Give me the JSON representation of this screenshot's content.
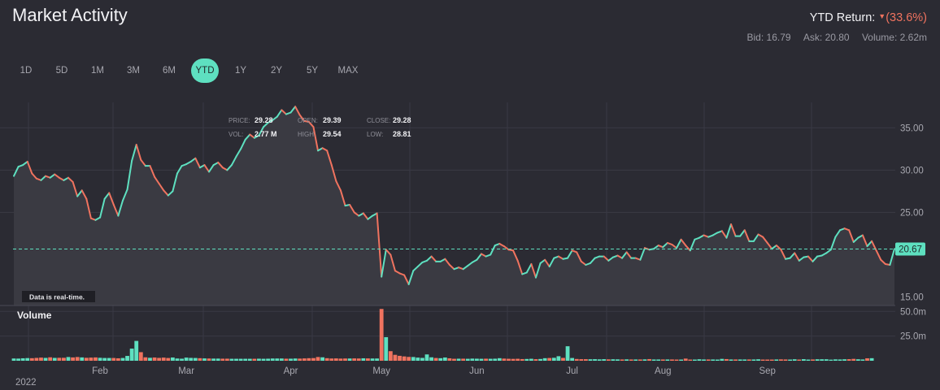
{
  "header": {
    "title": "Market Activity",
    "ytd_label": "YTD Return:",
    "ytd_value": "(33.6%)",
    "bid": "Bid: 16.79",
    "ask": "Ask: 20.80",
    "volume": "Volume: 2.62m"
  },
  "ranges": [
    {
      "label": "1D",
      "active": false
    },
    {
      "label": "5D",
      "active": false
    },
    {
      "label": "1M",
      "active": false
    },
    {
      "label": "3M",
      "active": false
    },
    {
      "label": "6M",
      "active": false
    },
    {
      "label": "YTD",
      "active": true
    },
    {
      "label": "1Y",
      "active": false
    },
    {
      "label": "2Y",
      "active": false
    },
    {
      "label": "5Y",
      "active": false
    },
    {
      "label": "MAX",
      "active": false
    }
  ],
  "tooltip": {
    "price_label": "PRICE:",
    "price": "29.28",
    "open_label": "OPEN:",
    "open": "29.39",
    "close_label": "CLOSE:",
    "close": "29.28",
    "vol_label": "VOL:",
    "vol": "2.77 M",
    "high_label": "HIGH:",
    "high": "29.54",
    "low_label": "LOW:",
    "low": "28.81"
  },
  "realtime_note": "Data is real-time.",
  "volume_title": "Volume",
  "year_label": "2022",
  "current_price_label": "20.67",
  "colors": {
    "up": "#5ee0c0",
    "down": "#f0735f",
    "area": "#3a3a42",
    "bg": "#2b2b33",
    "grid": "#3a3a44"
  },
  "chart_data": {
    "type": "line",
    "x_unit": "trading day index (0 = first trading day of 2022, 184 = last shown)",
    "xticks": [
      {
        "label": "Feb",
        "day": 19
      },
      {
        "label": "Mar",
        "day": 38
      },
      {
        "label": "Apr",
        "day": 61
      },
      {
        "label": "May",
        "day": 81
      },
      {
        "label": "Jun",
        "day": 102
      },
      {
        "label": "Jul",
        "day": 123
      },
      {
        "label": "Aug",
        "day": 143
      },
      {
        "label": "Sep",
        "day": 166
      }
    ],
    "price_ticks": [
      "35.00",
      "30.00",
      "25.00",
      "15.00"
    ],
    "price_tick_values": [
      35,
      30,
      25,
      15
    ],
    "ylim": [
      14,
      38
    ],
    "volume_ticks": [
      "50.0m",
      "25.0m"
    ],
    "volume_tick_values": [
      50,
      25
    ],
    "volume_ylim": [
      0,
      56
    ],
    "reference_price": 20.67,
    "price": [
      29.3,
      30.4,
      30.6,
      31.0,
      29.6,
      29.0,
      28.8,
      29.3,
      29.1,
      29.5,
      29.1,
      28.8,
      29.1,
      28.6,
      26.9,
      27.6,
      26.6,
      24.3,
      24.1,
      24.4,
      26.6,
      27.3,
      25.9,
      24.6,
      26.4,
      27.7,
      31.1,
      33.0,
      31.2,
      30.5,
      30.5,
      29.2,
      28.4,
      27.6,
      27.0,
      27.5,
      29.6,
      30.5,
      30.7,
      31.0,
      31.4,
      30.3,
      30.6,
      29.8,
      30.6,
      30.9,
      30.3,
      30.0,
      30.6,
      31.6,
      32.5,
      33.6,
      34.2,
      33.8,
      34.1,
      35.1,
      35.6,
      35.9,
      36.3,
      37.1,
      36.6,
      36.8,
      37.5,
      36.5,
      35.8,
      35.7,
      35.1,
      32.3,
      32.6,
      32.3,
      30.6,
      28.7,
      27.6,
      25.8,
      25.9,
      25.0,
      24.6,
      24.9,
      24.2,
      24.6,
      24.9,
      17.4,
      20.6,
      20.0,
      18.1,
      17.8,
      17.6,
      16.5,
      18.1,
      18.6,
      19.1,
      19.3,
      19.8,
      19.2,
      19.2,
      19.5,
      18.8,
      18.3,
      18.5,
      18.3,
      18.7,
      19.1,
      19.4,
      20.1,
      19.8,
      20.0,
      21.1,
      21.3,
      21.0,
      20.6,
      20.5,
      19.3,
      17.7,
      17.9,
      18.9,
      17.3,
      19.0,
      19.4,
      18.6,
      19.6,
      19.8,
      19.5,
      19.6,
      20.5,
      20.3,
      19.2,
      18.8,
      19.0,
      19.6,
      19.8,
      19.8,
      19.3,
      19.7,
      19.9,
      19.6,
      20.3,
      19.6,
      19.6,
      19.4,
      20.8,
      20.6,
      20.7,
      21.1,
      20.9,
      21.4,
      21.2,
      20.8,
      21.8,
      21.1,
      20.5,
      21.8,
      22.0,
      22.3,
      22.1,
      22.3,
      22.6,
      22.8,
      22.0,
      23.6,
      22.2,
      22.2,
      22.9,
      21.6,
      21.6,
      22.4,
      22.1,
      21.4,
      20.7,
      21.1,
      20.6,
      19.5,
      19.6,
      20.2,
      19.3,
      19.7,
      19.8,
      19.2,
      19.8,
      19.9,
      20.2,
      20.6,
      22.1,
      22.9,
      23.1,
      22.9,
      21.5,
      22.0,
      22.3,
      21.0,
      21.6,
      20.5,
      19.4,
      18.9,
      18.8,
      20.7
    ],
    "volume": [
      2.3,
      2.2,
      2.5,
      2.7,
      2.6,
      2.9,
      3.2,
      2.9,
      3.5,
      2.9,
      3.0,
      3.0,
      3.8,
      3.4,
      3.8,
      3.4,
      3.0,
      3.2,
      3.4,
      3.0,
      2.8,
      2.8,
      2.8,
      2.5,
      2.8,
      4.9,
      12.3,
      20.1,
      8.7,
      3.5,
      3.0,
      3.3,
      2.9,
      3.2,
      2.8,
      3.3,
      2.3,
      2.1,
      3.2,
      2.9,
      2.8,
      2.6,
      2.4,
      2.3,
      2.2,
      2.2,
      2.1,
      2.1,
      2.0,
      2.0,
      2.0,
      2.0,
      2.0,
      2.0,
      2.1,
      2.0,
      2.1,
      2.3,
      2.3,
      2.3,
      2.1,
      2.1,
      2.3,
      2.2,
      2.4,
      2.6,
      2.7,
      3.8,
      3.5,
      2.6,
      2.3,
      2.4,
      2.2,
      2.3,
      2.3,
      2.4,
      2.3,
      2.5,
      2.4,
      2.3,
      2.3,
      52.5,
      23.9,
      9.7,
      6.0,
      5.0,
      4.4,
      3.9,
      3.8,
      3.2,
      2.9,
      6.4,
      3.5,
      2.8,
      2.6,
      3.3,
      2.5,
      2.0,
      2.1,
      2.1,
      2.0,
      2.2,
      2.1,
      2.0,
      2.1,
      2.0,
      2.1,
      2.6,
      2.2,
      2.0,
      1.9,
      2.0,
      1.7,
      1.8,
      2.0,
      1.6,
      1.8,
      2.6,
      2.8,
      3.0,
      4.6,
      2.9,
      14.7,
      2.8,
      1.8,
      1.6,
      1.6,
      1.5,
      1.6,
      1.4,
      1.6,
      1.4,
      1.5,
      1.4,
      1.3,
      1.4,
      1.3,
      1.3,
      1.3,
      1.4,
      1.7,
      1.3,
      1.3,
      1.3,
      1.3,
      1.3,
      1.2,
      1.2,
      2.2,
      1.2,
      1.2,
      1.5,
      1.3,
      1.3,
      1.3,
      1.2,
      1.9,
      1.7,
      1.3,
      1.3,
      1.3,
      1.3,
      1.3,
      1.3,
      1.5,
      1.2,
      1.2,
      1.2,
      1.3,
      1.4,
      1.3,
      1.2,
      1.5,
      1.2,
      1.6,
      1.2,
      1.3,
      1.5,
      1.5,
      1.5,
      1.1,
      1.4,
      1.3,
      1.5,
      1.6,
      1.9,
      1.5,
      1.3,
      2.5,
      2.6
    ]
  }
}
